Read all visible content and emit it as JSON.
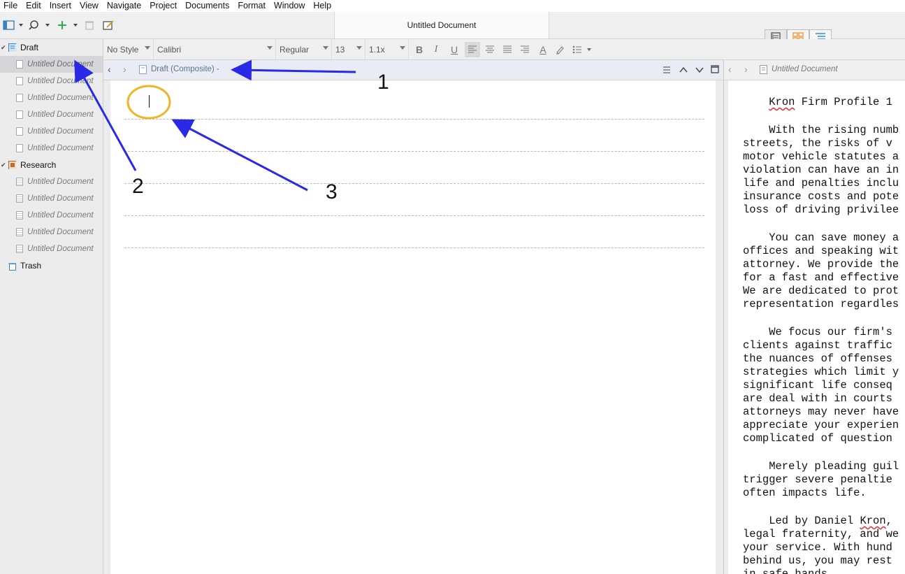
{
  "menu": [
    "File",
    "Edit",
    "Insert",
    "View",
    "Navigate",
    "Project",
    "Documents",
    "Format",
    "Window",
    "Help"
  ],
  "window_title": "Untitled Document",
  "binder": {
    "draft_label": "Draft",
    "draft_children": [
      "Untitled Document",
      "Untitled Document",
      "Untitled Document",
      "Untitled Document",
      "Untitled Document",
      "Untitled Document"
    ],
    "research_label": "Research",
    "research_children": [
      "Untitled Document",
      "Untitled Document",
      "Untitled Document",
      "Untitled Document",
      "Untitled Document"
    ],
    "trash_label": "Trash"
  },
  "format_bar": {
    "style": "No Style",
    "font": "Calibri",
    "weight": "Regular",
    "size": "13",
    "spacing": "1.1x",
    "bold": "B",
    "italic": "I",
    "underline": "U",
    "text_color": "A"
  },
  "editor_header": {
    "title": "Draft (Composite) -"
  },
  "right_header": {
    "title": "Untitled Document"
  },
  "right_doc": {
    "title_pre": "    ",
    "title_word": "Kron",
    "title_post": " Firm Profile 1",
    "paragraphs": [
      [
        "    With the rising numb",
        "streets, the risks of v",
        "motor vehicle statutes a",
        "violation can have an in",
        "life and penalties inclu",
        "insurance costs and pote",
        "loss of driving privilee"
      ],
      [
        "    You can save money a",
        "offices and speaking wit",
        "attorney. We provide the",
        "for a fast and effective",
        "We are dedicated to prot",
        "representation regardles"
      ],
      [
        "    We focus our firm's",
        "clients against traffic",
        "the nuances of offenses",
        "strategies which limit y",
        "significant life conseq",
        "are deal with in courts",
        "attorneys may never have",
        "appreciate your experien",
        "complicated of question"
      ],
      [
        "    Merely pleading guil",
        "trigger severe penaltie",
        "often impacts life."
      ]
    ],
    "last_pre": "    Led by Daniel ",
    "last_word": "Kron",
    "last_post": ",",
    "last_lines": [
      "legal fraternity, and we",
      "your service. With hund",
      "behind us, you may rest",
      "in safe hands."
    ]
  },
  "annotations": {
    "label1": "1",
    "label2": "2",
    "label3": "3"
  },
  "colors": {
    "arrow": "#2a2ae6",
    "circle": "#f0b429",
    "header_bg": "#e9ecf4"
  }
}
